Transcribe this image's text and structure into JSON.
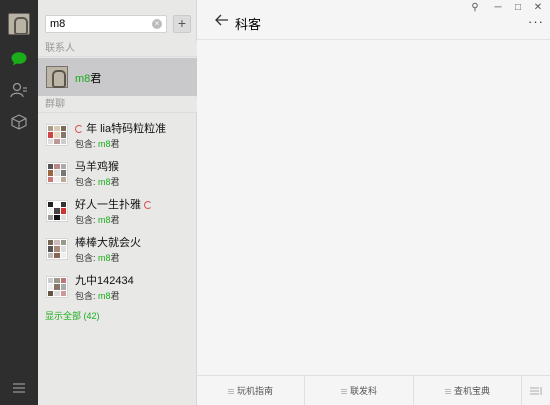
{
  "window": {
    "pin_symbol": "⚲",
    "minimize_symbol": "─",
    "maximize_symbol": "□",
    "close_symbol": "✕"
  },
  "sidebar": {
    "icons": [
      "avatar",
      "chat-icon",
      "contacts-icon",
      "favorites-icon",
      "menu-icon"
    ],
    "active_color": "#1aad19"
  },
  "search": {
    "value": "m8",
    "clear_symbol": "×",
    "add_symbol": "+"
  },
  "contacts_section": {
    "label": "联系人",
    "items": [
      {
        "name_highlight": "m8",
        "name_rest": "君"
      }
    ]
  },
  "groups_section": {
    "label": "群聊",
    "items": [
      {
        "name_prefix": "",
        "has_mark_before": true,
        "name": "年 lia特码粒粒准",
        "has_mark_after": false,
        "sub_label": "包含: ",
        "sub_highlight": "m8",
        "sub_rest": "君"
      },
      {
        "name_prefix": "",
        "has_mark_before": false,
        "name": "马羊鸡猴",
        "has_mark_after": false,
        "sub_label": "包含: ",
        "sub_highlight": "m8",
        "sub_rest": "君"
      },
      {
        "name_prefix": "",
        "has_mark_before": false,
        "name": "好人一生扑雅",
        "has_mark_after": true,
        "sub_label": "包含: ",
        "sub_highlight": "m8",
        "sub_rest": "君"
      },
      {
        "name_prefix": "",
        "has_mark_before": false,
        "name": "棒棒大就会火",
        "has_mark_after": false,
        "sub_label": "包含: ",
        "sub_highlight": "m8",
        "sub_rest": "君"
      },
      {
        "name_prefix": "",
        "has_mark_before": false,
        "name": "九中142434",
        "has_mark_after": false,
        "sub_label": "包含: ",
        "sub_highlight": "m8",
        "sub_rest": "君"
      }
    ],
    "show_all": "显示全部 (42)"
  },
  "chat": {
    "title": "科客",
    "more_symbol": "···"
  },
  "bottom_menu": {
    "items": [
      "玩机指南",
      "联发科",
      "查机宝典"
    ]
  }
}
